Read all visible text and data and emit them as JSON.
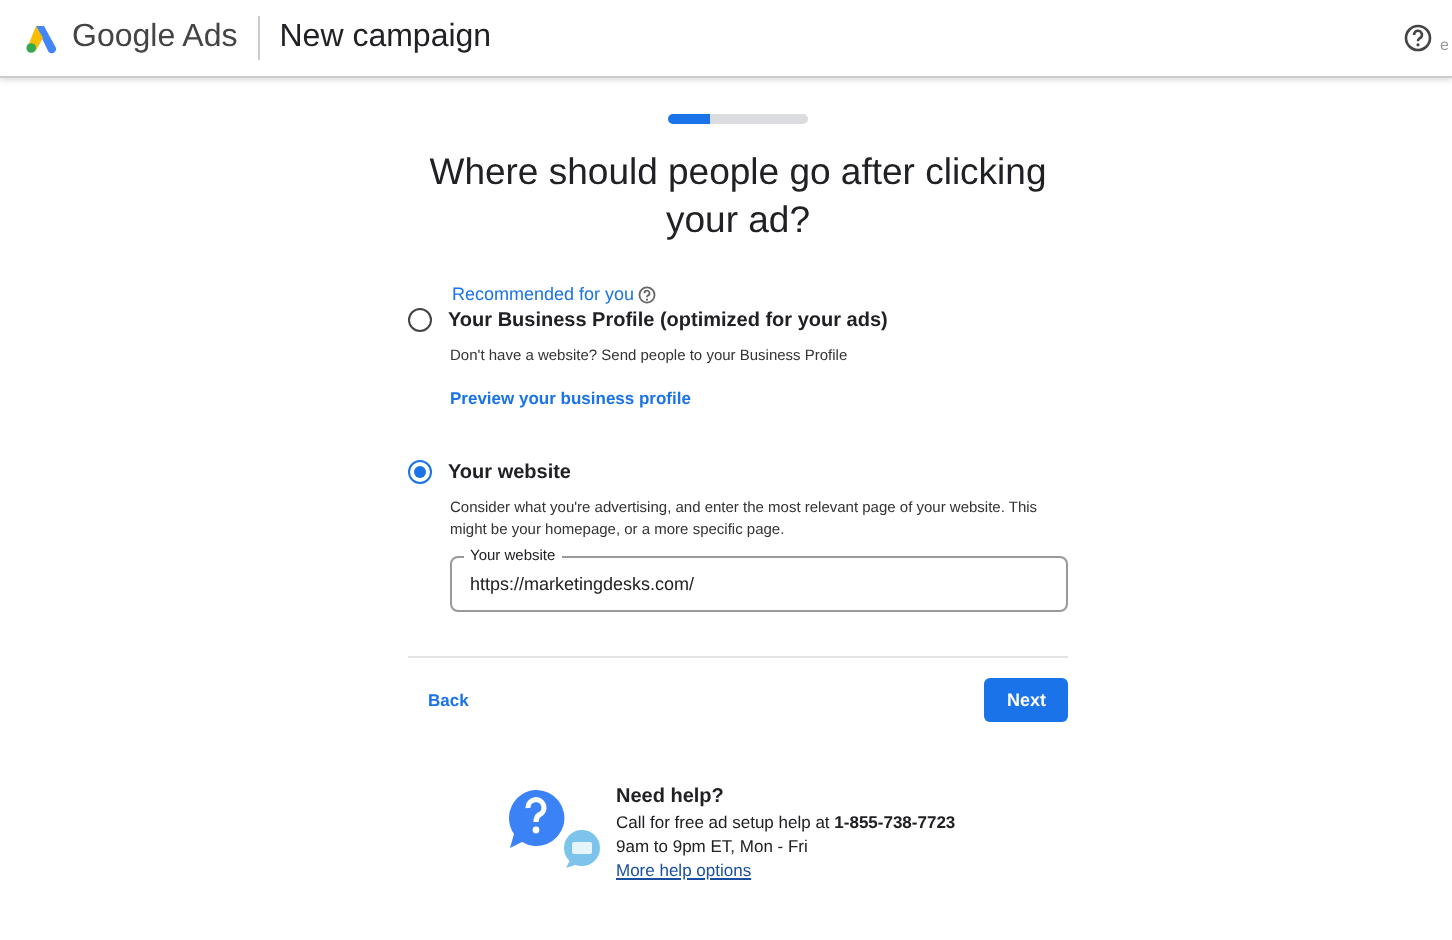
{
  "header": {
    "brand": "Google Ads",
    "title": "New campaign",
    "edge_text": "e"
  },
  "progress": {
    "level": 0.3
  },
  "heading": "Where should people go after clicking your ad?",
  "recommended": "Recommended for you",
  "options": [
    {
      "label": "Your Business Profile (optimized for your ads)",
      "description": "Don't have a website? Send people to your Business Profile",
      "link": "Preview your business profile",
      "selected": false
    },
    {
      "label": "Your website",
      "description": "Consider what you're advertising, and enter the most relevant page of your website. This might be your homepage, or a more specific page.",
      "field_label": "Your website",
      "field_value": "https://marketingdesks.com/",
      "selected": true
    }
  ],
  "buttons": {
    "back": "Back",
    "next": "Next"
  },
  "help": {
    "title": "Need help?",
    "call_text": "Call for free ad setup help at **1-855-738-7723**",
    "hours": "9am to 9pm ET, Mon - Fri",
    "link": "More help options"
  }
}
